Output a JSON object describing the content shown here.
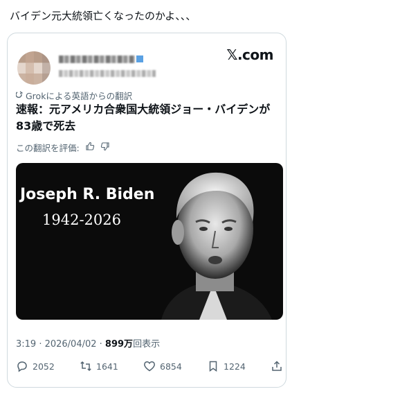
{
  "post": {
    "text": "バイデン元大統領亡くなったのかよ、、、"
  },
  "embed": {
    "brand": "𝕏.com",
    "translate_note": "Grokによる英語からの翻訳",
    "headline": "速報：元アメリカ合衆国大統領ジョー・バイデンが83歳で死去",
    "rate_label": "この翻訳を評価:",
    "media": {
      "name": "Joseph R. Biden",
      "years": "1942-2026"
    },
    "meta": {
      "timestamp": "3:19 · 2026/04/02 · ",
      "views_count": "899万",
      "views_label": "回表示"
    },
    "actions": {
      "replies": "2052",
      "reposts": "1641",
      "likes": "6854",
      "bookmarks": "1224"
    }
  },
  "colors": {
    "muted": "#536471",
    "text": "#0f1419",
    "border": "#cfd9de"
  }
}
